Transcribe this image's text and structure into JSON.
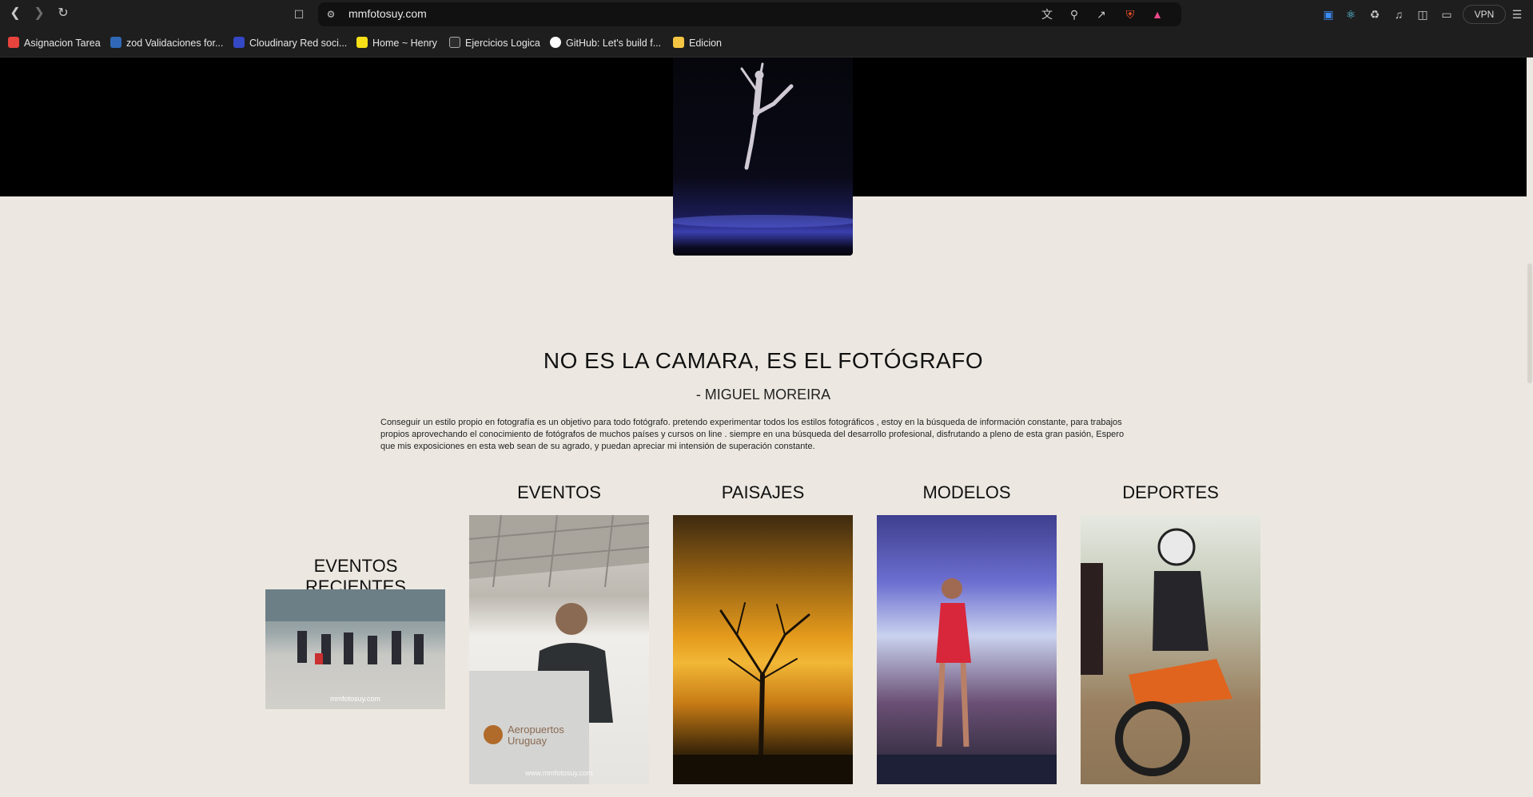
{
  "browser": {
    "url": "mmfotosuy.com",
    "vpn_label": "VPN",
    "nav": {
      "back": "back-icon",
      "forward": "forward-icon",
      "reload": "reload-icon"
    },
    "bookmarks": [
      {
        "label": "Asignacion Tarea",
        "color": "#e8433d"
      },
      {
        "label": "zod Validaciones for...",
        "color": "#3068b7"
      },
      {
        "label": "Cloudinary Red soci...",
        "color": "#3448c5"
      },
      {
        "label": "Home ~ Henry",
        "color": "#f7e017"
      },
      {
        "label": "Ejercicios Logica",
        "color": "#2d2d2d"
      },
      {
        "label": "GitHub: Let's build f...",
        "color": "#ffffff"
      },
      {
        "label": "Edicion",
        "color": "#f4c542"
      }
    ]
  },
  "page": {
    "headline": "NO ES LA CAMARA, ES EL FOTÓGRAFO",
    "author": "- MIGUEL MOREIRA",
    "bio": "Conseguir un estilo propio en fotografía es un objetivo para todo fotógrafo. pretendo experimentar todos los estilos fotográficos , estoy en la búsqueda de información constante, para trabajos propios aprovechando el conocimiento de fotógrafos de muchos países y cursos on line . siempre en una búsqueda del desarrollo profesional, disfrutando a pleno de esta gran pasión, Espero que mis exposiciones en esta web sean de su agrado, y puedan apreciar mi intensión de superación constante.",
    "recent_title": "EVENTOS RECIENTES",
    "categories": [
      {
        "title": "EVENTOS",
        "watermark": "www.mmfotosuy.com"
      },
      {
        "title": "PAISAJES"
      },
      {
        "title": "MODELOS"
      },
      {
        "title": "DEPORTES"
      }
    ],
    "recent_watermark": "mmfotosuy.com",
    "event_podium_text": "Aeropuertos Uruguay"
  }
}
